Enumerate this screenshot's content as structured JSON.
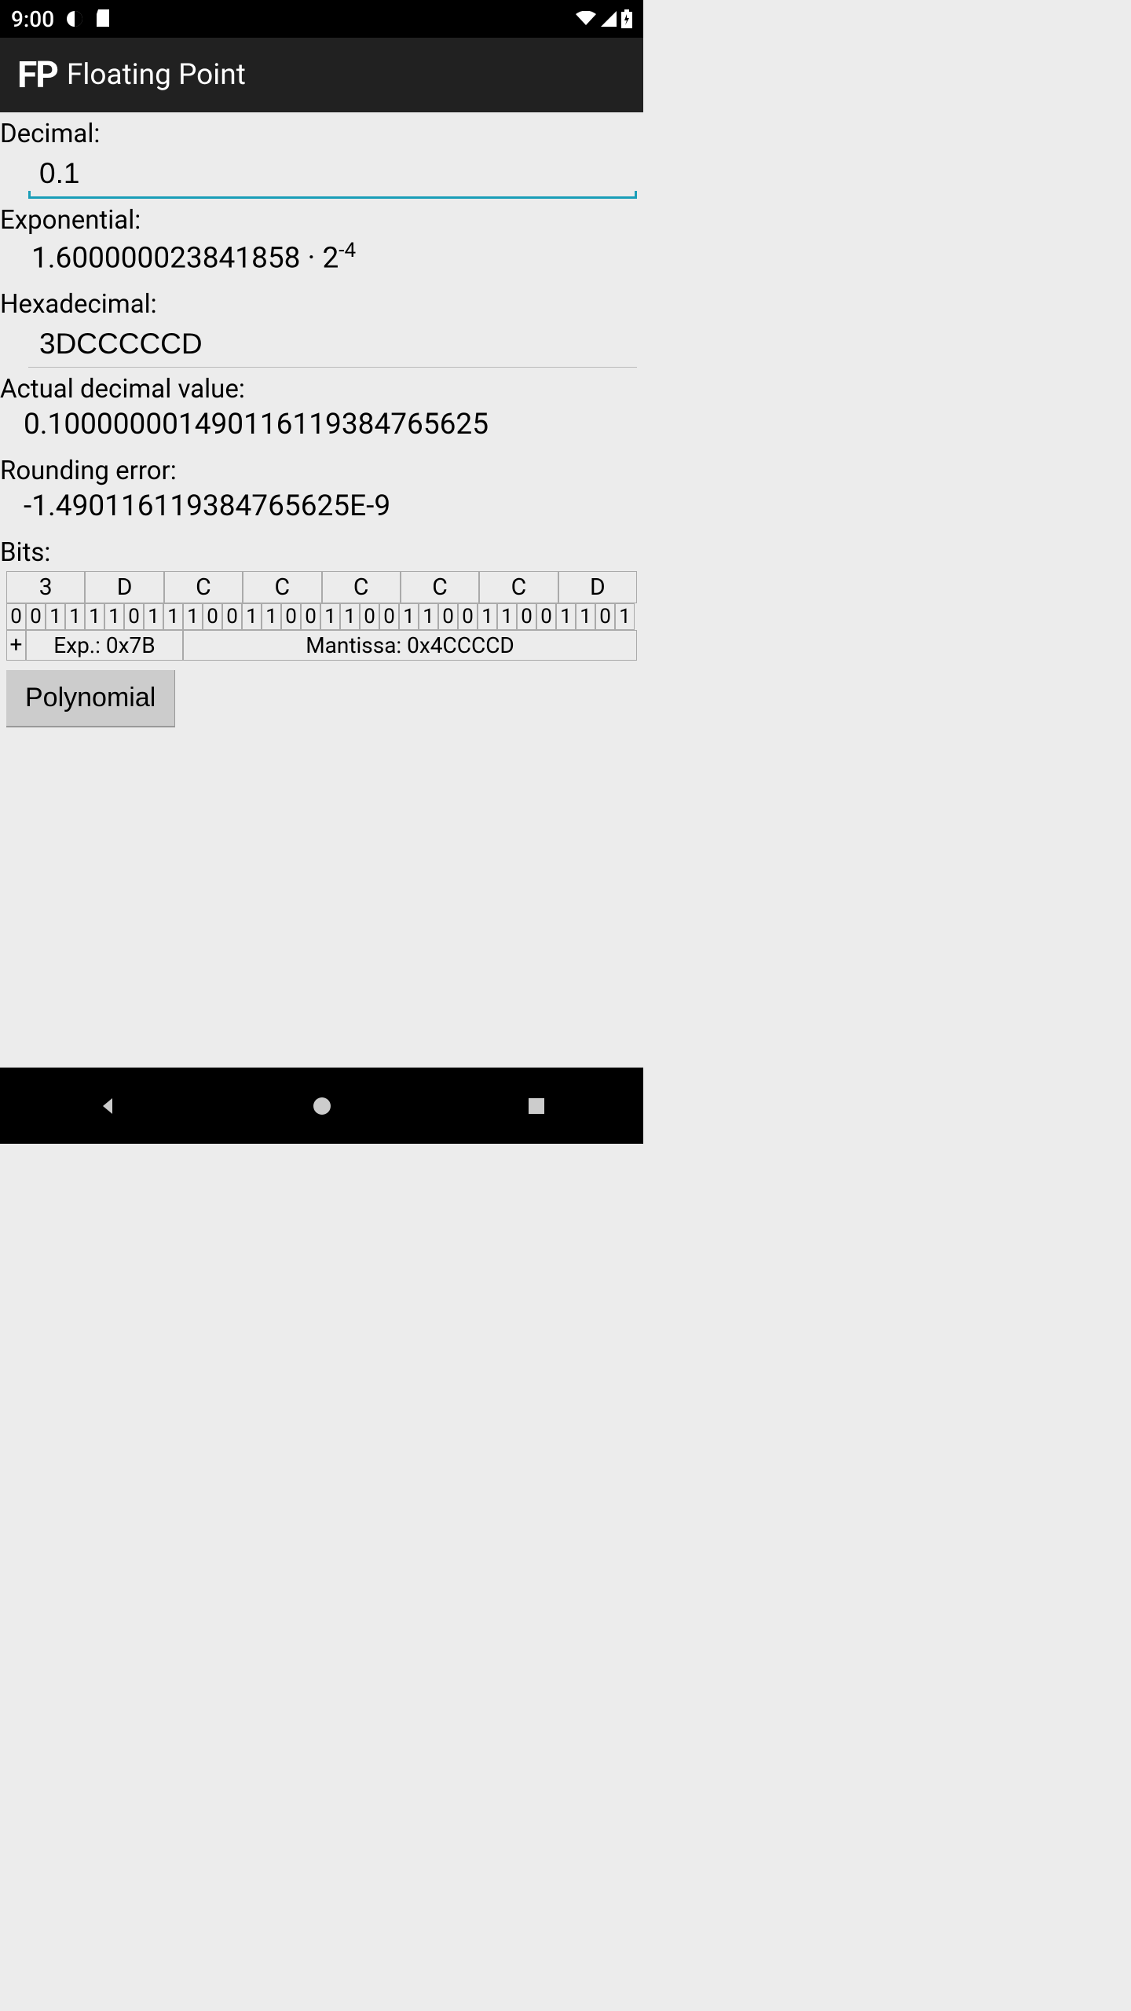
{
  "status_bar": {
    "time": "9:00"
  },
  "app": {
    "logo": "FP",
    "title": "Floating Point"
  },
  "labels": {
    "decimal": "Decimal:",
    "exponential": "Exponential:",
    "hexadecimal": "Hexadecimal:",
    "actual_decimal": "Actual decimal value:",
    "rounding_error": "Rounding error:",
    "bits": "Bits:"
  },
  "values": {
    "decimal_input": "0.1",
    "exponential_mantissa": "1.600000023841858",
    "exponential_base": "2",
    "exponential_exp": "-4",
    "hexadecimal_input": "3DCCCCCD",
    "actual_decimal": "0.100000001490116119384765625",
    "rounding_error": "-1.490116119384765625E-9"
  },
  "bits": {
    "nibbles": [
      "3",
      "D",
      "C",
      "C",
      "C",
      "C",
      "C",
      "D"
    ],
    "bits": [
      "0",
      "0",
      "1",
      "1",
      "1",
      "1",
      "0",
      "1",
      "1",
      "1",
      "0",
      "0",
      "1",
      "1",
      "0",
      "0",
      "1",
      "1",
      "0",
      "0",
      "1",
      "1",
      "0",
      "0",
      "1",
      "1",
      "0",
      "0",
      "1",
      "1",
      "0",
      "1"
    ],
    "sign": "+",
    "exp_label": "Exp.: 0x7B",
    "mantissa_label": "Mantissa: 0x4CCCCD"
  },
  "buttons": {
    "polynomial": "Polynomial"
  }
}
